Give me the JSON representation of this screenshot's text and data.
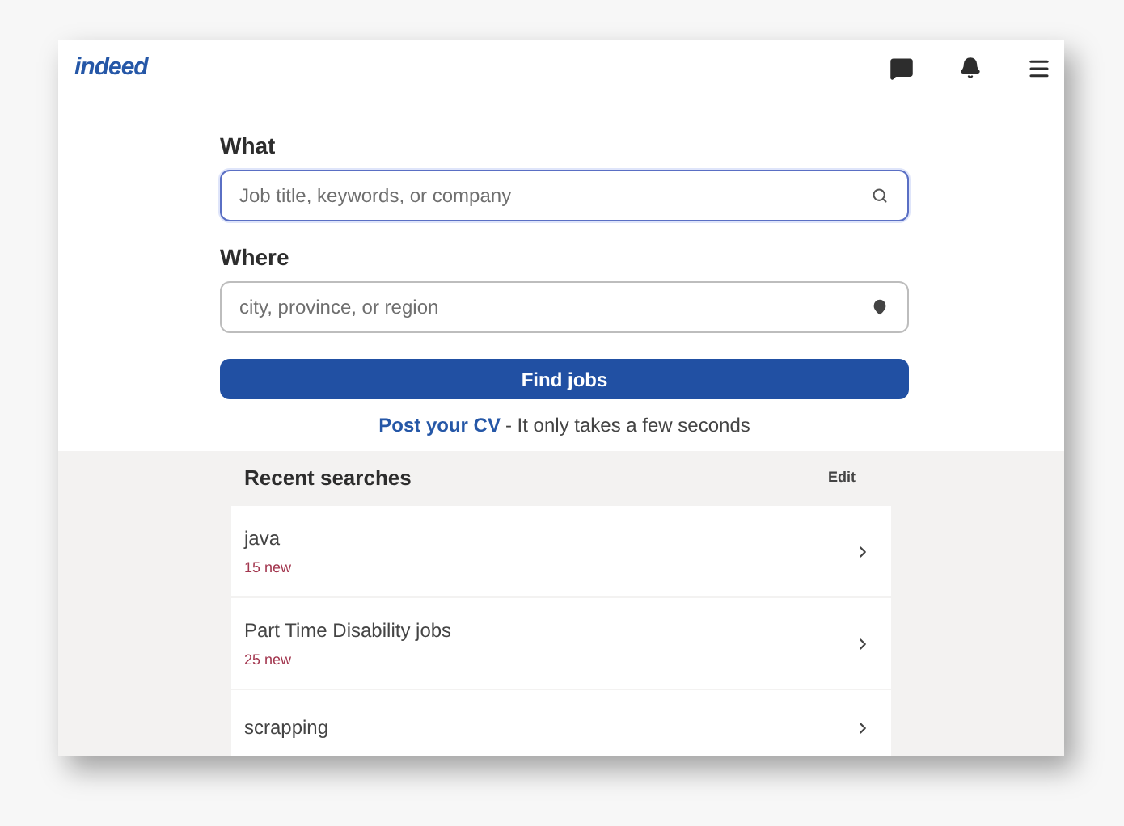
{
  "header": {
    "logo": "indeed"
  },
  "what": {
    "label": "What",
    "placeholder": "Job title, keywords, or company",
    "focused": true
  },
  "where": {
    "label": "Where",
    "placeholder": "city, province, or region",
    "focused": false
  },
  "find_button": "Find jobs",
  "post_cv": {
    "link": "Post your CV",
    "text": "- It only takes a few seconds"
  },
  "recent": {
    "title": "Recent searches",
    "edit": "Edit",
    "items": [
      {
        "title": "java",
        "new_count": "15 new"
      },
      {
        "title": "Part Time Disability jobs",
        "new_count": "25 new"
      },
      {
        "title": "scrapping"
      }
    ]
  }
}
